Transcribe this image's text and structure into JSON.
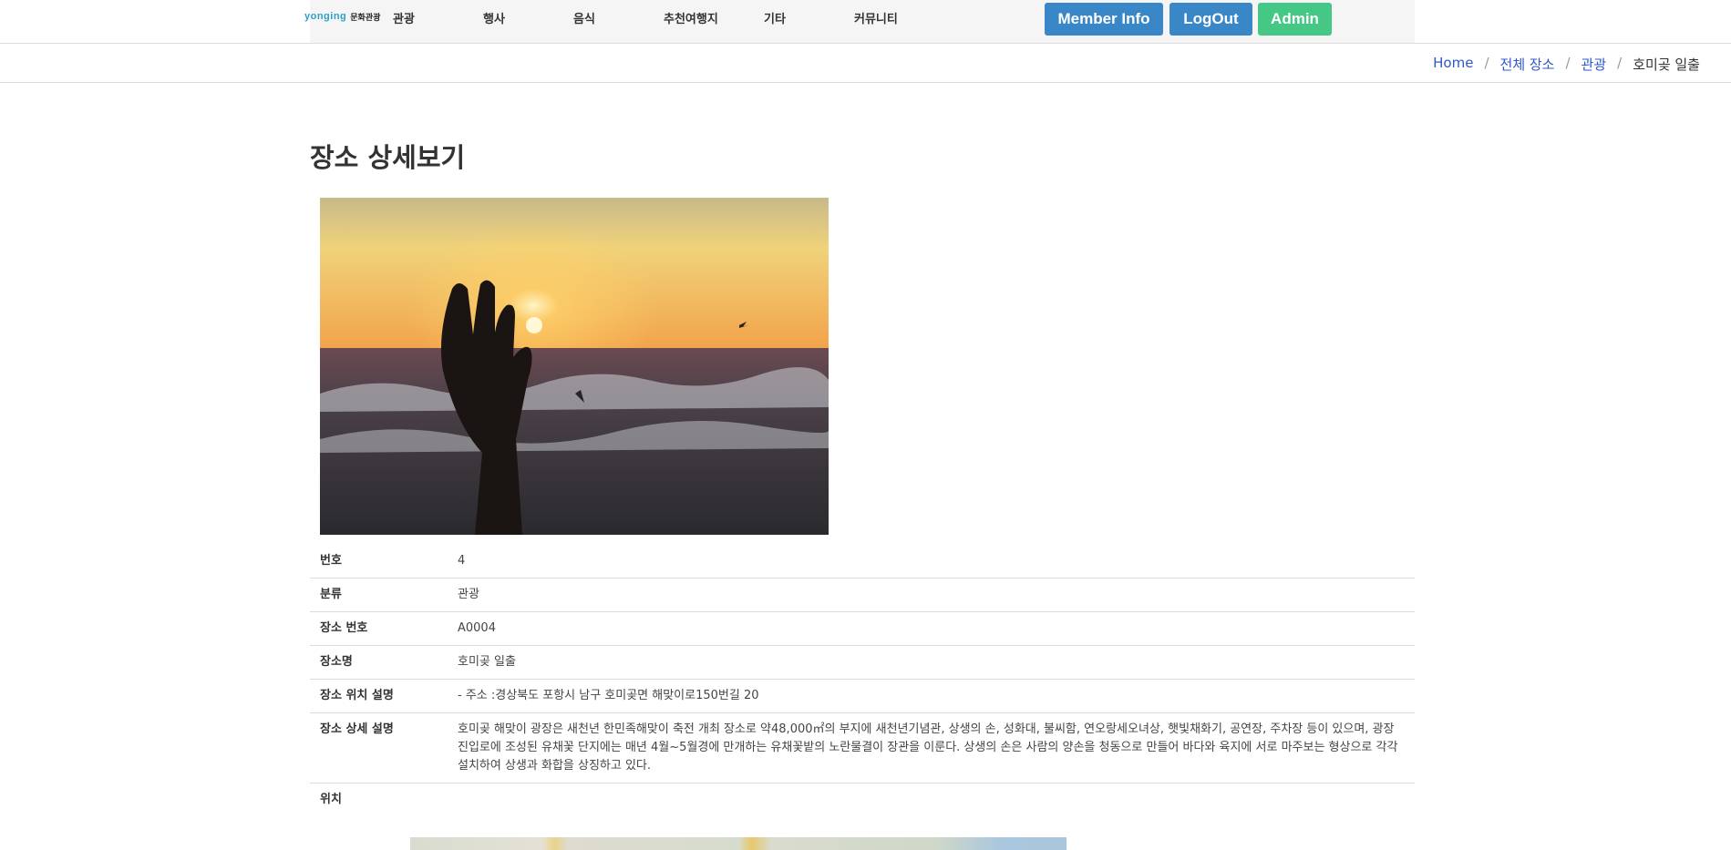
{
  "header": {
    "logo_mark": "yonging",
    "logo_name": "문화관광",
    "menu": [
      "관광",
      "행사",
      "음식",
      "추천여행지",
      "기타",
      "커뮤니티"
    ],
    "buttons": {
      "member_info": "Member Info",
      "logout": "LogOut",
      "admin": "Admin"
    }
  },
  "breadcrumb": {
    "home": "Home",
    "all": "전체 장소",
    "category": "관광",
    "current": "호미곶 일출",
    "separator": "/"
  },
  "page_title": "장소 상세보기",
  "details": {
    "rows": [
      {
        "label": "번호",
        "value": "4"
      },
      {
        "label": "분류",
        "value": "관광"
      },
      {
        "label": "장소 번호",
        "value": "A0004"
      },
      {
        "label": "장소명",
        "value": "호미곶 일출"
      },
      {
        "label": "장소 위치 설명",
        "value": "- 주소 :경상북도 포항시 남구 호미곶면 해맞이로150번길 20"
      },
      {
        "label": "장소 상세 설명",
        "value": "호미곶 해맞이 광장은 새천년 한민족해맞이 축전 개최 장소로 약48,000㎡의 부지에 새천년기념관, 상생의 손, 성화대, 불씨함, 연오랑세오녀상, 햇빛채화기, 공연장, 주차장 등이 있으며, 광장 진입로에 조성된 유채꽃 단지에는 매년 4월~5월경에 만개하는 유채꽃밭의 노란물결이 장관을 이룬다. 상생의 손은 사람의 양손을 청동으로 만들어 바다와 육지에 서로 마주보는 형상으로 각각 설치하여 상생과 화합을 상징하고 있다."
      },
      {
        "label": "위치",
        "value": ""
      }
    ]
  },
  "colors": {
    "primary_button": "#3a87c8",
    "admin_button": "#45c785",
    "breadcrumb_link": "#2f57c9"
  }
}
